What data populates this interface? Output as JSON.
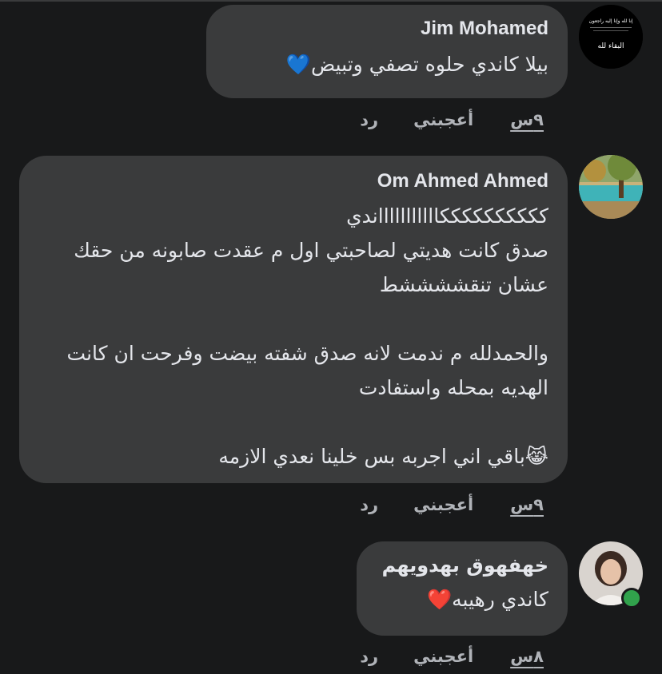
{
  "comments": [
    {
      "author": "Jim Mohamed",
      "text": "بيلا كاندي حلوه تصفي وتبيض💙",
      "time": "٩س",
      "like_label": "أعجبني",
      "reply_label": "رد",
      "avatar_text_top": "إنا لله وإنا إليه راجعون",
      "avatar_text_bottom": "البقاء لله"
    },
    {
      "author": "Om Ahmed Ahmed",
      "text": "ككككككككككاااااااااااندي\nصدق كانت هديتي لصاحبتي اول م عقدت صابونه من حقك عشان تنقششششط\n\nوالحمدلله م ندمت لانه صدق شفته بيضت وفرحت ان كانت الهديه بمحله  واستفادت\n\n😹باقي اني اجربه بس خلينا نعدي الازمه",
      "time": "٩س",
      "like_label": "أعجبني",
      "reply_label": "رد"
    },
    {
      "author": "خهفهوق بهدويهم",
      "text": "كاندي رهيبه❤️",
      "time": "٨س",
      "like_label": "أعجبني",
      "reply_label": "رد"
    }
  ],
  "colors": {
    "background": "#18191a",
    "bubble": "#3a3b3c",
    "text": "#e4e6eb",
    "meta": "#b0b3b8",
    "online": "#31a24c"
  }
}
